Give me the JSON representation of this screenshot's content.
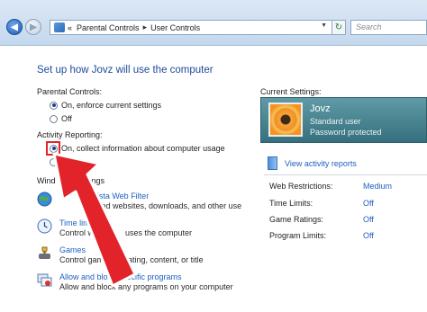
{
  "address_bar": {
    "crumb_overflow": "«",
    "crumb_1": "Parental Controls",
    "crumb_sep": "▸",
    "crumb_2": "User Controls",
    "search_placeholder": "Search"
  },
  "page_title": "Set up how Jovz will use the computer",
  "parental_controls": {
    "label": "Parental Controls:",
    "options": [
      {
        "label": "On, enforce current settings",
        "selected": true
      },
      {
        "label": "Off",
        "selected": false
      }
    ]
  },
  "activity_reporting": {
    "label": "Activity Reporting:",
    "options": [
      {
        "label": "On, collect information about computer usage",
        "selected": true
      }
    ]
  },
  "windows_settings": {
    "label_fragment": "Wind",
    "label_fragment_end": "ngs",
    "tasks": [
      {
        "link": "Vista Web Filter",
        "desc": "wed websites, downloads, and other use",
        "icon": "globe-icon"
      },
      {
        "link": "Time lim",
        "desc": "Control w              uses the computer",
        "icon": "clock-icon"
      },
      {
        "link": "Games",
        "desc": "Control games by rating, content, or title",
        "icon": "games-icon"
      },
      {
        "link": "Allow and block specific programs",
        "desc": "Allow and block any programs on your computer",
        "icon": "programs-icon"
      }
    ]
  },
  "current_settings": {
    "label": "Current Settings:",
    "user": {
      "name": "Jovz",
      "type": "Standard user",
      "password": "Password protected"
    },
    "view_reports": "View activity reports",
    "rows": [
      {
        "name": "Web Restrictions:",
        "value": "Medium"
      },
      {
        "name": "Time Limits:",
        "value": "Off"
      },
      {
        "name": "Game Ratings:",
        "value": "Off"
      },
      {
        "name": "Program Limits:",
        "value": "Off"
      }
    ]
  },
  "colors": {
    "accent": "#1e5fc0",
    "heading": "#1e4a9b",
    "arrow": "#e2232a",
    "card": "#4a8592"
  }
}
